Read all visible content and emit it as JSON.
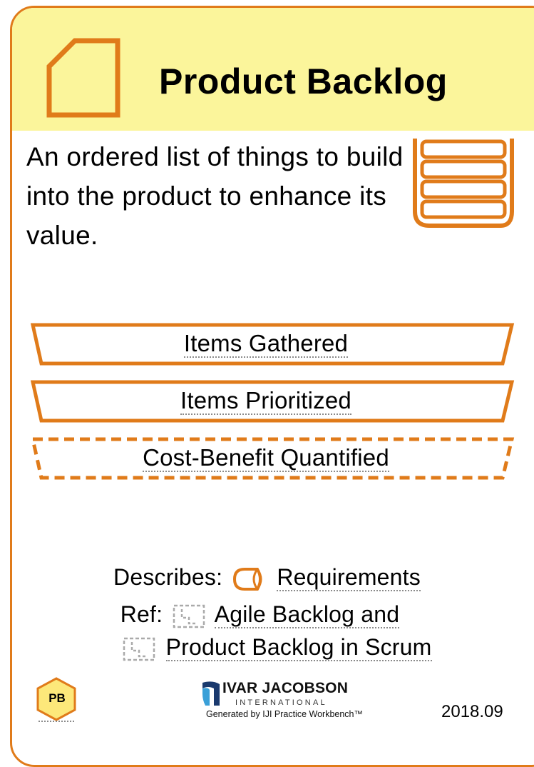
{
  "card": {
    "title": "Product Backlog",
    "description": "An ordered list of things to build into the product to enhance its value."
  },
  "states": [
    {
      "label": "Items Gathered",
      "style": "solid"
    },
    {
      "label": "Items Prioritized",
      "style": "solid"
    },
    {
      "label": "Cost-Benefit Quantified",
      "style": "dashed"
    }
  ],
  "references": {
    "describes_label": "Describes:",
    "describes_link": "Requirements",
    "ref_label": "Ref:",
    "ref_link_1": "Agile Backlog and",
    "ref_link_2": "Product Backlog in Scrum"
  },
  "footer": {
    "badge": "PB",
    "logo_main": "IVAR JACOBSON",
    "logo_sub": "INTERNATIONAL",
    "generated": "Generated by IJI Practice Workbench™",
    "version": "2018.09"
  },
  "colors": {
    "accent": "#e07b1a",
    "header_bg": "#fbf59b",
    "badge_bg": "#fde87a"
  },
  "icons": {
    "card_icon": "work-product-icon",
    "list_icon": "backlog-list-icon",
    "alpha_icon": "requirements-alpha-icon",
    "ref_icon": "reference-icon",
    "logo_icon": "iji-logo-icon"
  }
}
